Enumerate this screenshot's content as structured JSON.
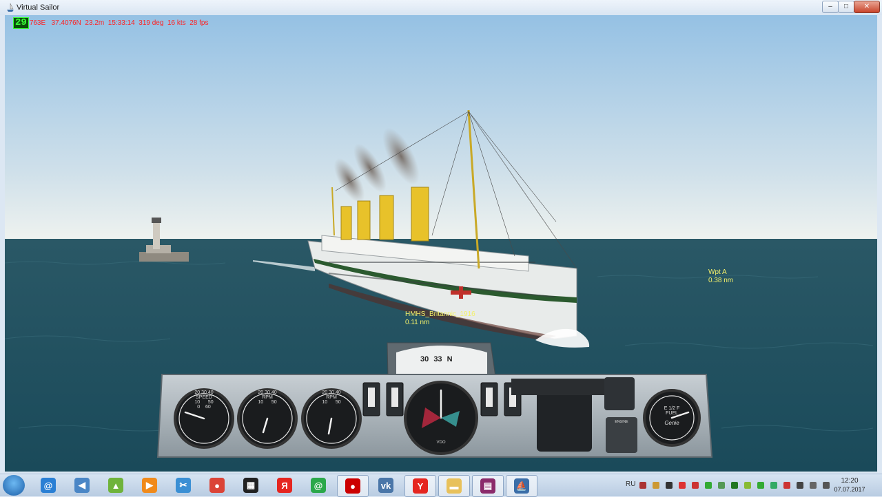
{
  "window": {
    "title": "Virtual Sailor",
    "minimize": "–",
    "maximize": "□",
    "close": "✕"
  },
  "hud": {
    "counter": "29",
    "readout": "763E   37.4076N  23.2m  15:33:14  319 deg  16 kts  28 fps"
  },
  "targets": [
    {
      "name": "HMHS_Britannic_1916",
      "distance": "0.11 nm"
    },
    {
      "name": "Wpt A",
      "distance": "0.38 nm"
    }
  ],
  "instruments": {
    "compass_ticks": [
      "30",
      "33",
      "N"
    ],
    "gauge_labels": [
      "SPEED",
      "RPM",
      "RPM",
      "FUEL"
    ],
    "speed_gauge_numbers": [
      "20",
      "30",
      "40",
      "10",
      "50",
      "0",
      "60"
    ],
    "rpm_gauge_numbers": [
      "20",
      "30",
      "40",
      "10",
      "50"
    ],
    "rpm2_gauge_numbers": [
      "20",
      "30",
      "40",
      "10",
      "50"
    ],
    "fuel_gauge_numbers": [
      "E",
      "1/2",
      "F"
    ],
    "vdo_label": "VDO",
    "engine_label": "ENGINE",
    "brand_label": "Genie"
  },
  "taskbar": {
    "apps": [
      {
        "icon": "internet-icon",
        "color": "#2a7fd4",
        "glyph": "@",
        "active": false
      },
      {
        "icon": "speaker-app-icon",
        "color": "#4a86c6",
        "glyph": "◀",
        "active": false
      },
      {
        "icon": "bluestacks-icon",
        "color": "#6fb33b",
        "glyph": "▲",
        "active": false
      },
      {
        "icon": "media-player-icon",
        "color": "#f08a1b",
        "glyph": "▶",
        "active": false
      },
      {
        "icon": "snipping-tool-icon",
        "color": "#3a8fd4",
        "glyph": "✂",
        "active": false
      },
      {
        "icon": "chrome-icon",
        "color": "#db4437",
        "glyph": "●",
        "active": false
      },
      {
        "icon": "film-icon",
        "color": "#222222",
        "glyph": "▦",
        "active": false
      },
      {
        "icon": "yandex-icon",
        "color": "#e52620",
        "glyph": "Я",
        "active": false
      },
      {
        "icon": "mail-agent-icon",
        "color": "#2ba84a",
        "glyph": "@",
        "active": false
      },
      {
        "icon": "record-icon",
        "color": "#cc0000",
        "glyph": "●",
        "active": true
      },
      {
        "icon": "vk-icon",
        "color": "#4a76a8",
        "glyph": "vk",
        "active": false
      },
      {
        "icon": "yandex-browser-icon",
        "color": "#e52620",
        "glyph": "Y",
        "active": true
      },
      {
        "icon": "folder-icon",
        "color": "#e8c15b",
        "glyph": "▬",
        "active": true
      },
      {
        "icon": "winrar-icon",
        "color": "#8b2b6b",
        "glyph": "▤",
        "active": true
      },
      {
        "icon": "virtual-sailor-icon",
        "color": "#3b6ea8",
        "glyph": "⛵",
        "active": true
      }
    ],
    "tray": {
      "lang": "RU",
      "time": "12:20",
      "date": "07.07.2017"
    },
    "tray_icon_colors": [
      "#a33",
      "#c93",
      "#333",
      "#d33",
      "#c33",
      "#3a3",
      "#595",
      "#272",
      "#8b3",
      "#3a3",
      "#3a6",
      "#c33",
      "#444",
      "#666",
      "#555"
    ]
  },
  "colors": {
    "sky_top": "#95c1e4",
    "sky_horizon": "#eef2ef",
    "sea": "#1d4d5c",
    "hud_red": "#ff2020",
    "label_yellow": "#f3f06b",
    "funnel": "#e8c22a"
  }
}
